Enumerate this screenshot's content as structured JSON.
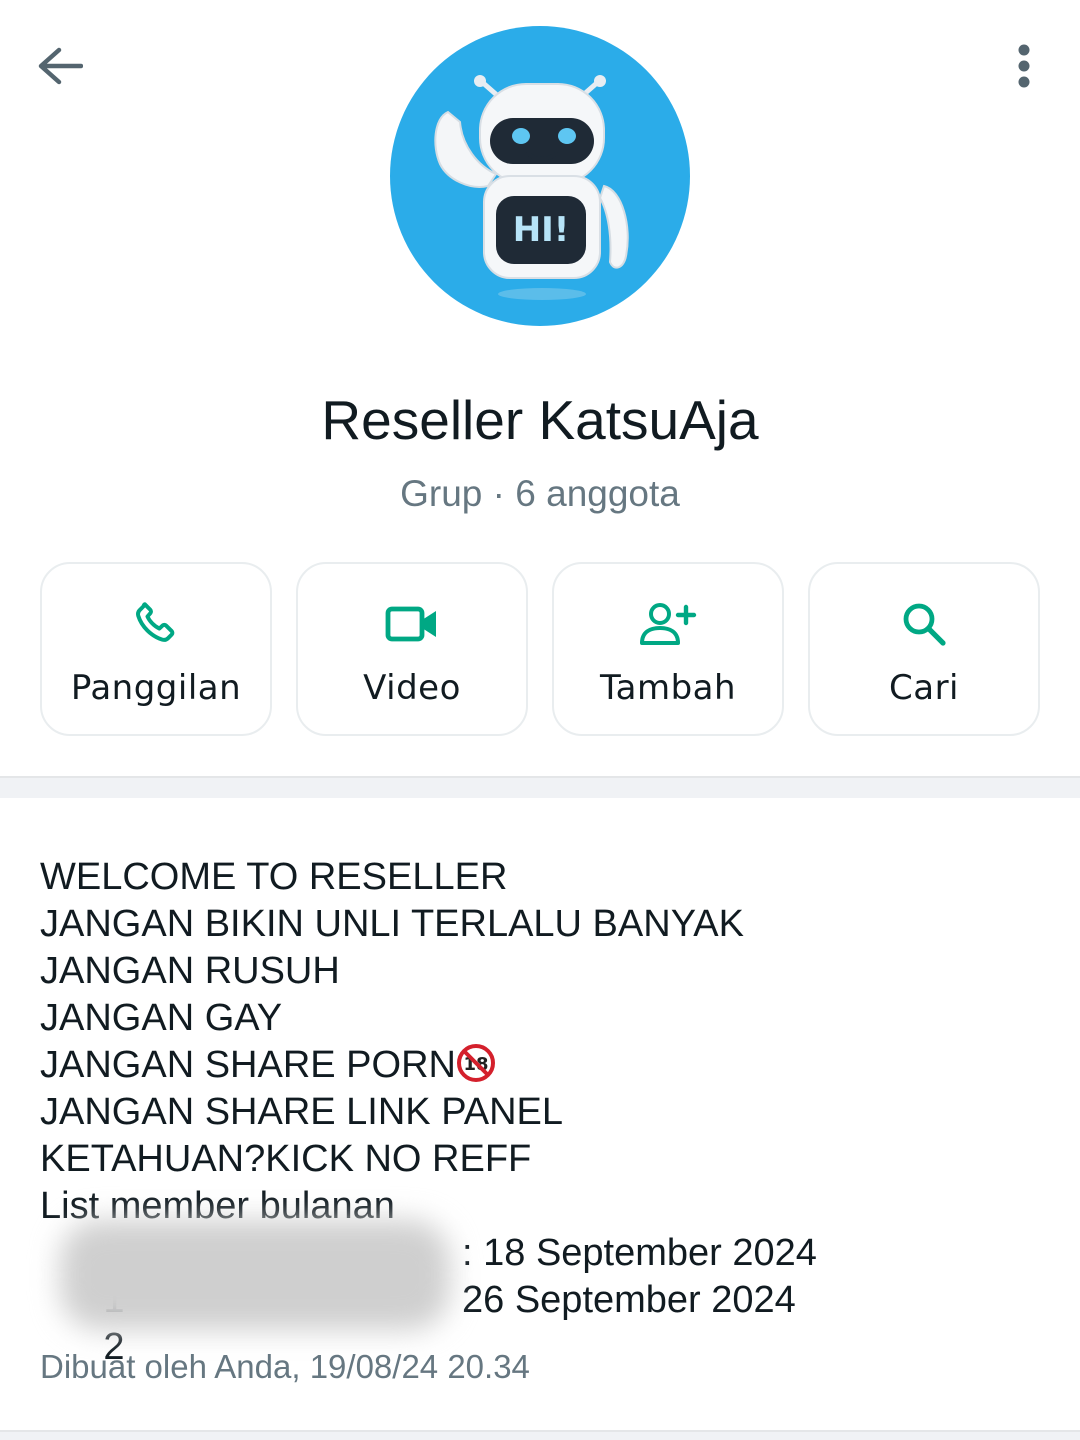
{
  "header": {
    "back_icon": "arrow-left-icon",
    "menu_icon": "more-vertical-icon"
  },
  "group": {
    "name": "Reseller KatsuAja",
    "subtitle": "Grup · 6 anggota",
    "avatar_text": "HI!",
    "avatar_bg": "#2bace9"
  },
  "actions": [
    {
      "label": "Panggilan",
      "icon": "phone-icon"
    },
    {
      "label": "Video",
      "icon": "video-icon"
    },
    {
      "label": "Tambah",
      "icon": "add-person-icon"
    },
    {
      "label": "Cari",
      "icon": "search-icon"
    }
  ],
  "accent_color": "#00a884",
  "description": {
    "lines": [
      "WELCOME TO RESELLER",
      "JANGAN BIKIN UNLI TERLALU BANYAK",
      "JANGAN RUSUH",
      "JANGAN GAY",
      "JANGAN SHARE PORN",
      "JANGAN SHARE LINK PANEL",
      "KETAHUAN?KICK NO REFF",
      "List member bulanan"
    ],
    "nsfw_emoji": "🔞",
    "members": [
      {
        "num": "1",
        "date": ": 18 September 2024"
      },
      {
        "num": "2",
        "date": "26 September 2024"
      }
    ]
  },
  "created": "Dibuat oleh Anda, 19/08/24 20.34"
}
